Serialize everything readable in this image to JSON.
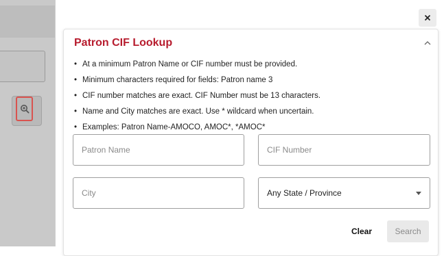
{
  "background": {
    "search_icon": "zoom-in-icon"
  },
  "modal": {
    "close_label": "×",
    "title": "Patron CIF Lookup",
    "rules": [
      "At a minimum Patron Name or CIF number must be provided.",
      "Minimum characters required for fields: Patron name 3",
      "CIF number matches are exact. CIF Number must be 13 characters.",
      "Name and City matches are exact. Use * wildcard when uncertain.",
      "Examples: Patron Name-AMOCO, AMOC*, *AMOC*"
    ],
    "bullet": "•",
    "fields": {
      "patron_name_placeholder": "Patron Name",
      "cif_number_placeholder": "CIF Number",
      "city_placeholder": "City",
      "state_selected": "Any State / Province"
    },
    "buttons": {
      "clear": "Clear",
      "search": "Search"
    }
  },
  "colors": {
    "title": "#b71c2e",
    "highlight": "#d9534f",
    "overlay": "#c9c9c9"
  }
}
